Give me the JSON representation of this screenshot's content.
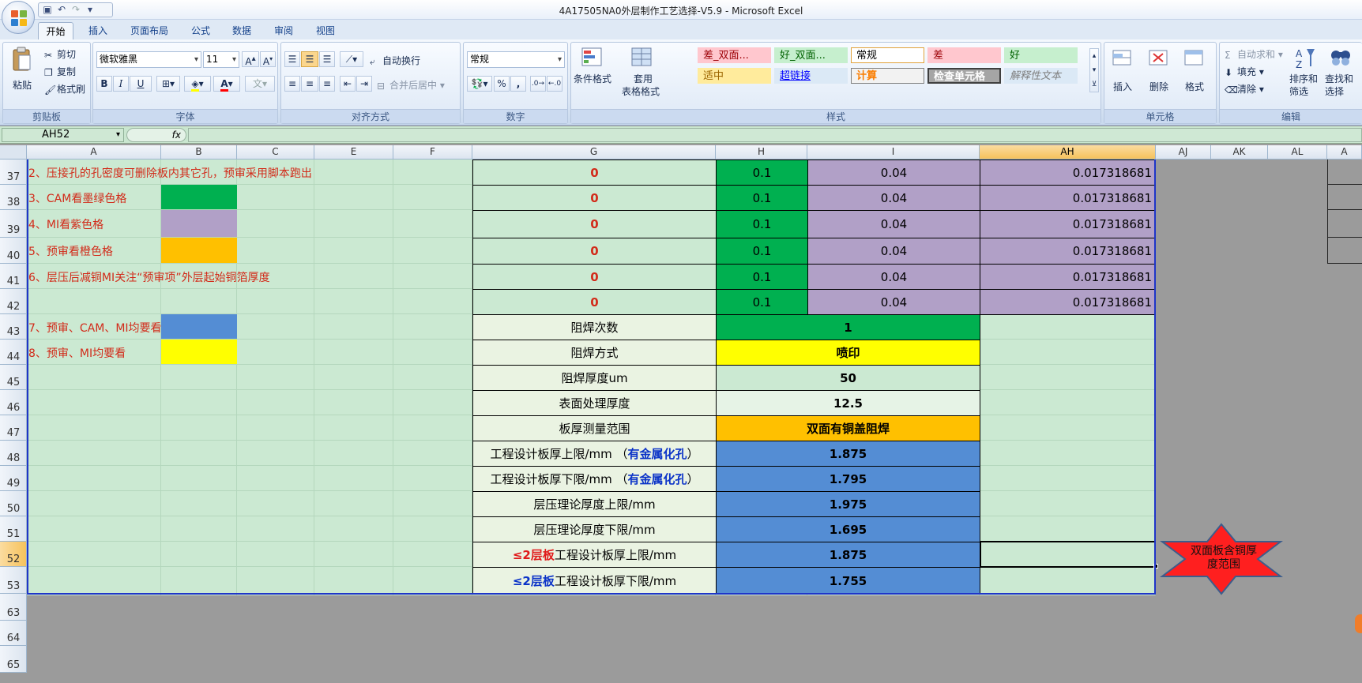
{
  "window": {
    "title": "4A17505NA0外层制作工艺选择-V5.9 - Microsoft Excel"
  },
  "qat": {
    "icons": [
      "save-icon",
      "undo-icon",
      "redo-icon",
      "customize-icon"
    ]
  },
  "tabs": [
    "开始",
    "插入",
    "页面布局",
    "公式",
    "数据",
    "审阅",
    "视图"
  ],
  "ribbon": {
    "clipboard": {
      "label": "剪贴板",
      "paste": "粘贴",
      "cut": "剪切",
      "copy": "复制",
      "format_painter": "格式刷"
    },
    "font": {
      "label": "字体",
      "name": "微软雅黑",
      "size": "11",
      "bold": "B",
      "italic": "I",
      "underline": "U",
      "font_color": "A"
    },
    "alignment": {
      "label": "对齐方式",
      "wrap": "自动换行",
      "merge": "合并后居中"
    },
    "number": {
      "label": "数字",
      "format": "常规",
      "percent": "%",
      "comma": ","
    },
    "styles": {
      "label": "样式",
      "cond_format": "条件格式",
      "table_format_1": "套用",
      "table_format_2": "表格格式",
      "cells": [
        {
          "text": "差_双面...",
          "bg": "#ffc7ce",
          "color": "#9c0006"
        },
        {
          "text": "好_双面...",
          "bg": "#c6efce",
          "color": "#006100"
        },
        {
          "text": "常规",
          "bg": "#ffffff",
          "color": "#000000"
        },
        {
          "text": "差",
          "bg": "#ffc7ce",
          "color": "#9c0006"
        },
        {
          "text": "好",
          "bg": "#c6efce",
          "color": "#006100"
        },
        {
          "text": "适中",
          "bg": "#ffeb9c",
          "color": "#9c6500"
        },
        {
          "text": "超链接",
          "bg": "#dbe9f6",
          "color": "#0000ff"
        },
        {
          "text": "计算",
          "bg": "#f2f2f2",
          "color": "#fa7d00"
        },
        {
          "text": "检查单元格",
          "bg": "#a5a5a5",
          "color": "#ffffff"
        },
        {
          "text": "解释性文本",
          "bg": "#dbe9f6",
          "color": "#7f7f7f"
        }
      ]
    },
    "cells_group": {
      "label": "单元格",
      "insert": "插入",
      "delete": "删除",
      "format": "格式"
    },
    "editing": {
      "label": "编辑",
      "autosum": "自动求和",
      "fill": "填充",
      "clear": "清除",
      "sort": "排序和",
      "sort2": "筛选",
      "find": "查找和",
      "find2": "选择"
    }
  },
  "formula_bar": {
    "name_box": "AH52",
    "fx": "fx",
    "value": ""
  },
  "columns": [
    "A",
    "B",
    "C",
    "E",
    "F",
    "G",
    "H",
    "I",
    "AH",
    "AJ",
    "AK",
    "AL",
    "A"
  ],
  "rows": [
    "37",
    "38",
    "39",
    "40",
    "41",
    "42",
    "43",
    "44",
    "45",
    "46",
    "47",
    "48",
    "49",
    "50",
    "51",
    "52",
    "53",
    "63",
    "64",
    "65"
  ],
  "notes": [
    "2、压接孔的孔密度可删除板内其它孔，预审采用脚本跑出",
    "3、CAM看墨绿色格",
    "4、MI看紫色格",
    "5、预审看橙色格",
    "6、层压后减铜MI关注“预审项”外层起始铜箔厚度",
    "7、预审、CAM、MI均要看",
    "8、预审、MI均要看"
  ],
  "colors": {
    "green": "#00b050",
    "purple": "#b1a0c7",
    "orange": "#ffc000",
    "blue": "#548dd4",
    "yellow": "#ffff00",
    "sheet": "#cbe9d2"
  },
  "upper_rows": [
    {
      "g": "0",
      "h": "0.1",
      "i": "0.04",
      "ah": "0.017318681"
    },
    {
      "g": "0",
      "h": "0.1",
      "i": "0.04",
      "ah": "0.017318681"
    },
    {
      "g": "0",
      "h": "0.1",
      "i": "0.04",
      "ah": "0.017318681"
    },
    {
      "g": "0",
      "h": "0.1",
      "i": "0.04",
      "ah": "0.017318681"
    },
    {
      "g": "0",
      "h": "0.1",
      "i": "0.04",
      "ah": "0.017318681"
    },
    {
      "g": "0",
      "h": "0.1",
      "i": "0.04",
      "ah": "0.017318681"
    }
  ],
  "params": [
    {
      "label": "阻焊次数",
      "value": "1"
    },
    {
      "label": "阻焊方式",
      "value": "喷印"
    },
    {
      "label": "阻焊厚度um",
      "value": "50"
    },
    {
      "label": "表面处理厚度",
      "value": "12.5"
    },
    {
      "label": "板厚测量范围",
      "value": "双面有铜盖阻焊"
    },
    {
      "label_pre": "工程设计板厚上限/mm （",
      "label_hl": "有金属化孔",
      "label_post": "）",
      "value": "1.875"
    },
    {
      "label_pre": "工程设计板厚下限/mm （",
      "label_hl": "有金属化孔",
      "label_post": "）",
      "value": "1.795"
    },
    {
      "label": "层压理论厚度上限/mm",
      "value": "1.975"
    },
    {
      "label": "层压理论厚度下限/mm",
      "value": "1.695"
    },
    {
      "label_hl": "≤2层板",
      "label_post": "工程设计板厚上限/mm",
      "value": "1.875"
    },
    {
      "label_hl": "≤2层板",
      "label_post": "工程设计板厚下限/mm",
      "value": "1.755"
    }
  ],
  "shape": {
    "text": "双面板含铜厚度范围"
  }
}
